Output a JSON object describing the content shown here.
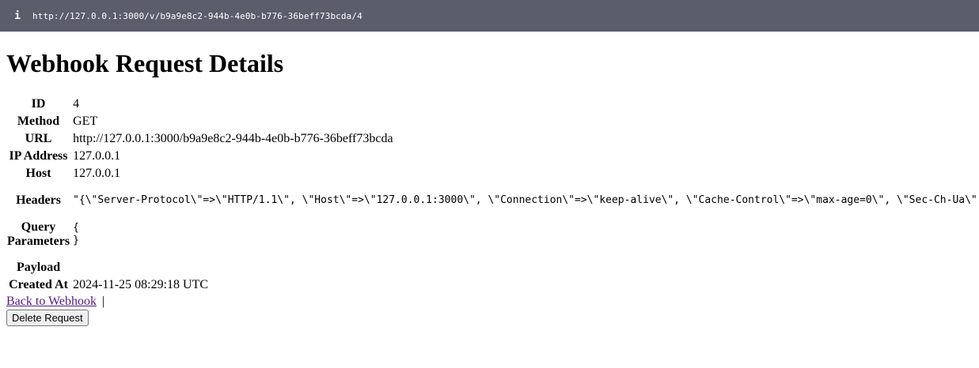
{
  "browser": {
    "info_icon": "i",
    "url": "http://127.0.0.1:3000/v/b9a9e8c2-944b-4e0b-b776-36beff73bcda/4"
  },
  "page": {
    "title": "Webhook Request Details"
  },
  "details": {
    "id_label": "ID",
    "id_value": "4",
    "method_label": "Method",
    "method_value": "GET",
    "url_label": "URL",
    "url_value": "http://127.0.0.1:3000/b9a9e8c2-944b-4e0b-b776-36beff73bcda",
    "ip_label": "IP Address",
    "ip_value": "127.0.0.1",
    "host_label": "Host",
    "host_value": "127.0.0.1",
    "headers_label": "Headers",
    "headers_value": "\"{\\\"Server-Protocol\\\"=>\\\"HTTP/1.1\\\", \\\"Host\\\"=>\\\"127.0.0.1:3000\\\", \\\"Connection\\\"=>\\\"keep-alive\\\", \\\"Cache-Control\\\"=>\\\"max-age=0\\\", \\\"Sec-Ch-Ua\\\"",
    "query_label_line1": "Query",
    "query_label_line2": "Parameters",
    "query_value": "{\n}",
    "payload_label": "Payload",
    "payload_value": "",
    "created_label": "Created At",
    "created_value": "2024-11-25 08:29:18 UTC"
  },
  "actions": {
    "back_label": "Back to Webhook",
    "separator": "|",
    "delete_label": "Delete Request"
  }
}
